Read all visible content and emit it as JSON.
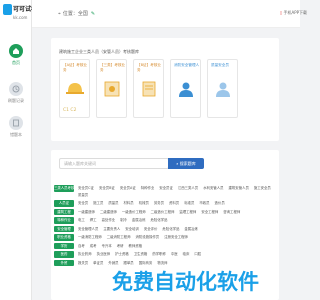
{
  "brand": {
    "name": "可可试卷",
    "domain": "kk.com"
  },
  "sidebar": {
    "items": [
      {
        "label": "首页",
        "icon": "home-icon",
        "active": true
      },
      {
        "label": "刷题记录",
        "icon": "record-icon",
        "active": false
      },
      {
        "label": "错题本",
        "icon": "book-icon",
        "active": false
      }
    ]
  },
  "topbar": {
    "location_prefix": "位置：",
    "location": "全国",
    "app_download": "手机APP下载"
  },
  "exam_card": {
    "title": "建筑施工企业三类人员（安管人员）考核题库",
    "tag": "",
    "tiles": [
      {
        "label": "【A证】考核业务",
        "bottom": "C1  C2",
        "color": "orange"
      },
      {
        "label": "【三类】考核业务",
        "bottom": "",
        "color": "orange"
      },
      {
        "label": "【B证】考核业务",
        "bottom": "",
        "color": "orange"
      },
      {
        "label": "消防安全管理人",
        "bottom": "",
        "color": "blue"
      },
      {
        "label": "质量安全员",
        "bottom": "",
        "color": "blue"
      }
    ]
  },
  "search": {
    "placeholder": "请输入题库关键词",
    "button": "搜索题库"
  },
  "categories": [
    {
      "label": "三类人员考核",
      "items": [
        "安全员C证",
        "安全员B证",
        "安全员A证",
        "特种作业",
        "安全员证",
        "江西三类人员",
        "水利安管人员",
        "建筑安管人员",
        "施工安全员",
        "质量员"
      ]
    },
    {
      "label": "人员证",
      "items": [
        "安全员",
        "施工员",
        "质量员",
        "材料员",
        "机械员",
        "劳务员",
        "资料员",
        "标准员",
        "市政员",
        "造价员"
      ]
    },
    {
      "label": "建筑工程",
      "items": [
        "一级建造师",
        "二级建造师",
        "一级造价工程师",
        "二级造价工程师",
        "监理工程师",
        "安全工程师",
        "咨询工程师"
      ]
    },
    {
      "label": "特种作业",
      "items": [
        "电工",
        "焊工",
        "高处作业",
        "制冷",
        "金属冶炼",
        "危险化学品"
      ]
    },
    {
      "label": "安全管理",
      "items": [
        "安全管理人员",
        "主要负责人",
        "安全培训",
        "安全评价",
        "危险化学品",
        "金属冶炼"
      ]
    },
    {
      "label": "职业资格",
      "items": [
        "一级消防工程师",
        "二级消防工程师",
        "消防设施操作员",
        "注册安全工程师"
      ]
    },
    {
      "label": "学历",
      "items": [
        "自考",
        "成考",
        "专升本",
        "考研",
        "教师资格"
      ]
    },
    {
      "label": "医药",
      "items": [
        "执业药师",
        "执业医师",
        "护士资格",
        "卫生资格",
        "药学职称",
        "中医",
        "临床",
        "口腔"
      ]
    },
    {
      "label": "外贸",
      "items": [
        "报关员",
        "单证员",
        "外销员",
        "跟单员",
        "国际商务",
        "物流师"
      ]
    }
  ],
  "watermark": {
    "text": "免费自动化软件",
    "color": "#1aa0e8"
  }
}
